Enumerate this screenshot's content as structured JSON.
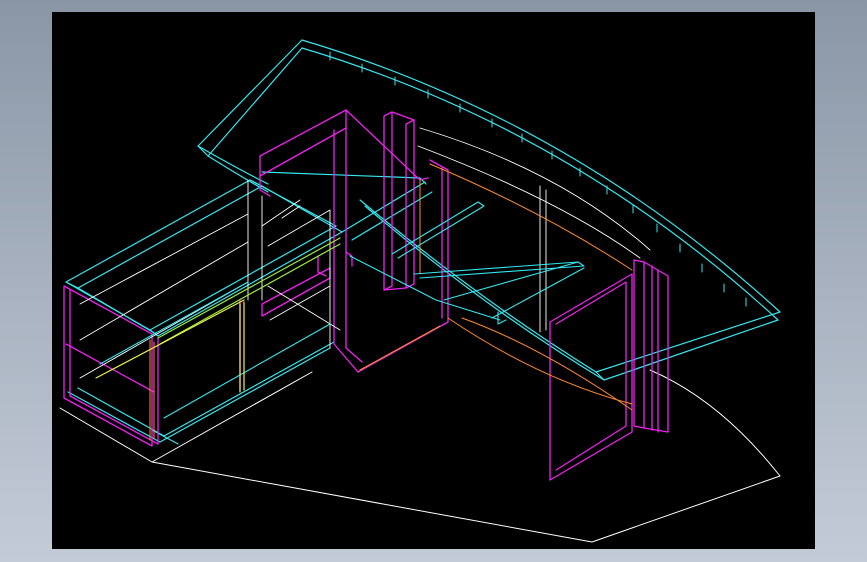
{
  "viewport": {
    "background": "#000000",
    "palette": {
      "cyan": "#35e6ee",
      "magenta": "#ee22ee",
      "white": "#ffffff",
      "orange": "#ff8a2a",
      "yellow": "#f0f04a",
      "green": "#9aee3a"
    },
    "subject": "wireframe-3d-curved-reception-desk"
  }
}
